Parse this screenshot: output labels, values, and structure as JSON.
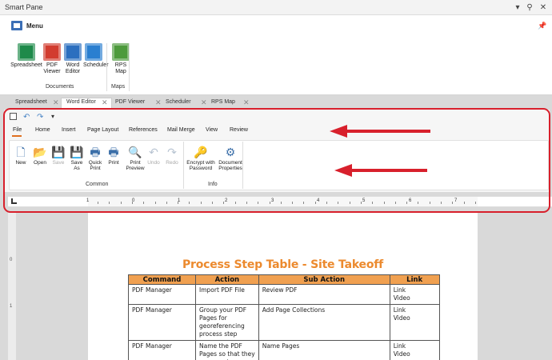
{
  "window": {
    "title": "Smart Pane"
  },
  "menu": {
    "label": "Menu"
  },
  "apps": {
    "documents_group": "Documents",
    "maps_group": "Maps",
    "items": [
      {
        "label": "Spreadsheet",
        "icon": "spreadsheet-icon",
        "color": "#1e8a4a"
      },
      {
        "label": "PDF\nViewer",
        "icon": "pdf-icon",
        "color": "#d23c2f"
      },
      {
        "label": "Word\nEditor",
        "icon": "word-editor-icon",
        "color": "#2c6fbf"
      },
      {
        "label": "Scheduler",
        "icon": "scheduler-icon",
        "color": "#2a7fd0"
      },
      {
        "label": "RPS\nMap",
        "icon": "map-icon",
        "color": "#4d9a3c"
      }
    ]
  },
  "doc_tabs": [
    "Spreadsheet",
    "Word Editor",
    "PDF Viewer",
    "Scheduler",
    "RPS Map"
  ],
  "ribbon": {
    "tabs": [
      "File",
      "Home",
      "Insert",
      "Page Layout",
      "References",
      "Mail Merge",
      "View",
      "Review"
    ],
    "active_tab": "File",
    "groups": [
      {
        "label": "Common"
      },
      {
        "label": "Info"
      }
    ],
    "buttons": [
      {
        "label": "New",
        "icon": "new-document-icon"
      },
      {
        "label": "Open",
        "icon": "folder-open-icon"
      },
      {
        "label": "Save",
        "icon": "save-icon",
        "disabled": true
      },
      {
        "label": "Save\nAs",
        "icon": "save-as-icon"
      },
      {
        "label": "Quick\nPrint",
        "icon": "quick-print-icon"
      },
      {
        "label": "Print",
        "icon": "print-icon"
      },
      {
        "label": "Print\nPreview",
        "icon": "print-preview-icon"
      },
      {
        "label": "Undo",
        "icon": "undo-icon",
        "disabled": true
      },
      {
        "label": "Redo",
        "icon": "redo-icon",
        "disabled": true
      },
      {
        "label": "Encrypt with\nPassword",
        "icon": "encrypt-key-icon"
      },
      {
        "label": "Document\nProperties",
        "icon": "document-properties-icon"
      }
    ]
  },
  "ruler": {
    "marks": [
      "1",
      "0",
      "1",
      "2",
      "3",
      "4",
      "5",
      "6",
      "7"
    ]
  },
  "vertical_ruler": {
    "marks": [
      "0",
      "1"
    ]
  },
  "document": {
    "title": "Process Step Table - Site Takeoff",
    "headers": [
      "Command",
      "Action",
      "Sub Action",
      "Link"
    ],
    "rows": [
      [
        "PDF Manager",
        "Import PDF File",
        "Review PDF",
        "Link\nVideo"
      ],
      [
        "PDF Manager",
        "Group your PDF\nPages for\ngeoreferencing\nprocess step",
        "Add Page Collections",
        "Link\nVideo"
      ],
      [
        "PDF Manager",
        "Name the PDF\nPages so that they\nare easy to",
        "Name Pages",
        "Link\nVideo"
      ]
    ]
  },
  "annotation": {
    "color": "#d8202c"
  }
}
